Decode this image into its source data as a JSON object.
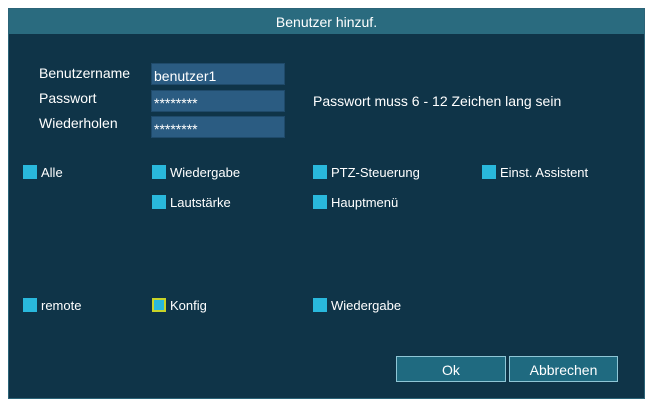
{
  "dialog": {
    "title": "Benutzer hinzuf.",
    "username_label": "Benutzername",
    "username_value": "benutzer1",
    "password_label": "Passwort",
    "password_value": "********",
    "repeat_label": "Wiederholen",
    "repeat_value": "********",
    "password_hint": "Passwort muss 6 - 12  Zeichen lang sein"
  },
  "permissions": {
    "all": "Alle",
    "playback": "Wiedergabe",
    "ptz": "PTZ-Steuerung",
    "wizard": "Einst. Assistent",
    "volume": "Lautstärke",
    "main_menu": "Hauptmenü"
  },
  "remote_permissions": {
    "remote": "remote",
    "config": "Konfig",
    "playback": "Wiedergabe"
  },
  "buttons": {
    "ok": "Ok",
    "cancel": "Abbrechen"
  },
  "colors": {
    "dialog_bg": "#0f3448",
    "titlebar_bg": "#2a6b7f",
    "checkbox": "#29b8dc",
    "focus": "#c8d428"
  }
}
